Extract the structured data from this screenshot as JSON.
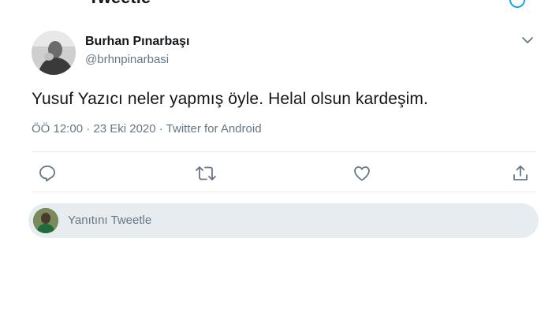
{
  "header": {
    "title": "Tweetle"
  },
  "tweet": {
    "author_name": "Burhan Pınarbaşı",
    "author_handle": "@brhnpinarbasi",
    "text": "Yusuf Yazıcı neler yapmış öyle. Helal olsun kardeşim.",
    "meta": "ÖÖ 12:00 · 23 Eki 2020 · Twitter for Android"
  },
  "actions": [
    {
      "icon": "reply-icon"
    },
    {
      "icon": "retweet-icon"
    },
    {
      "icon": "like-icon"
    },
    {
      "icon": "share-icon"
    }
  ],
  "reply": {
    "placeholder": "Yanıtını Tweetle"
  },
  "colors": {
    "accent": "#1da1f2",
    "text": "#14171a",
    "muted": "#657786",
    "divider": "#e6ecf0",
    "reply_bg": "#e6ecf0"
  }
}
